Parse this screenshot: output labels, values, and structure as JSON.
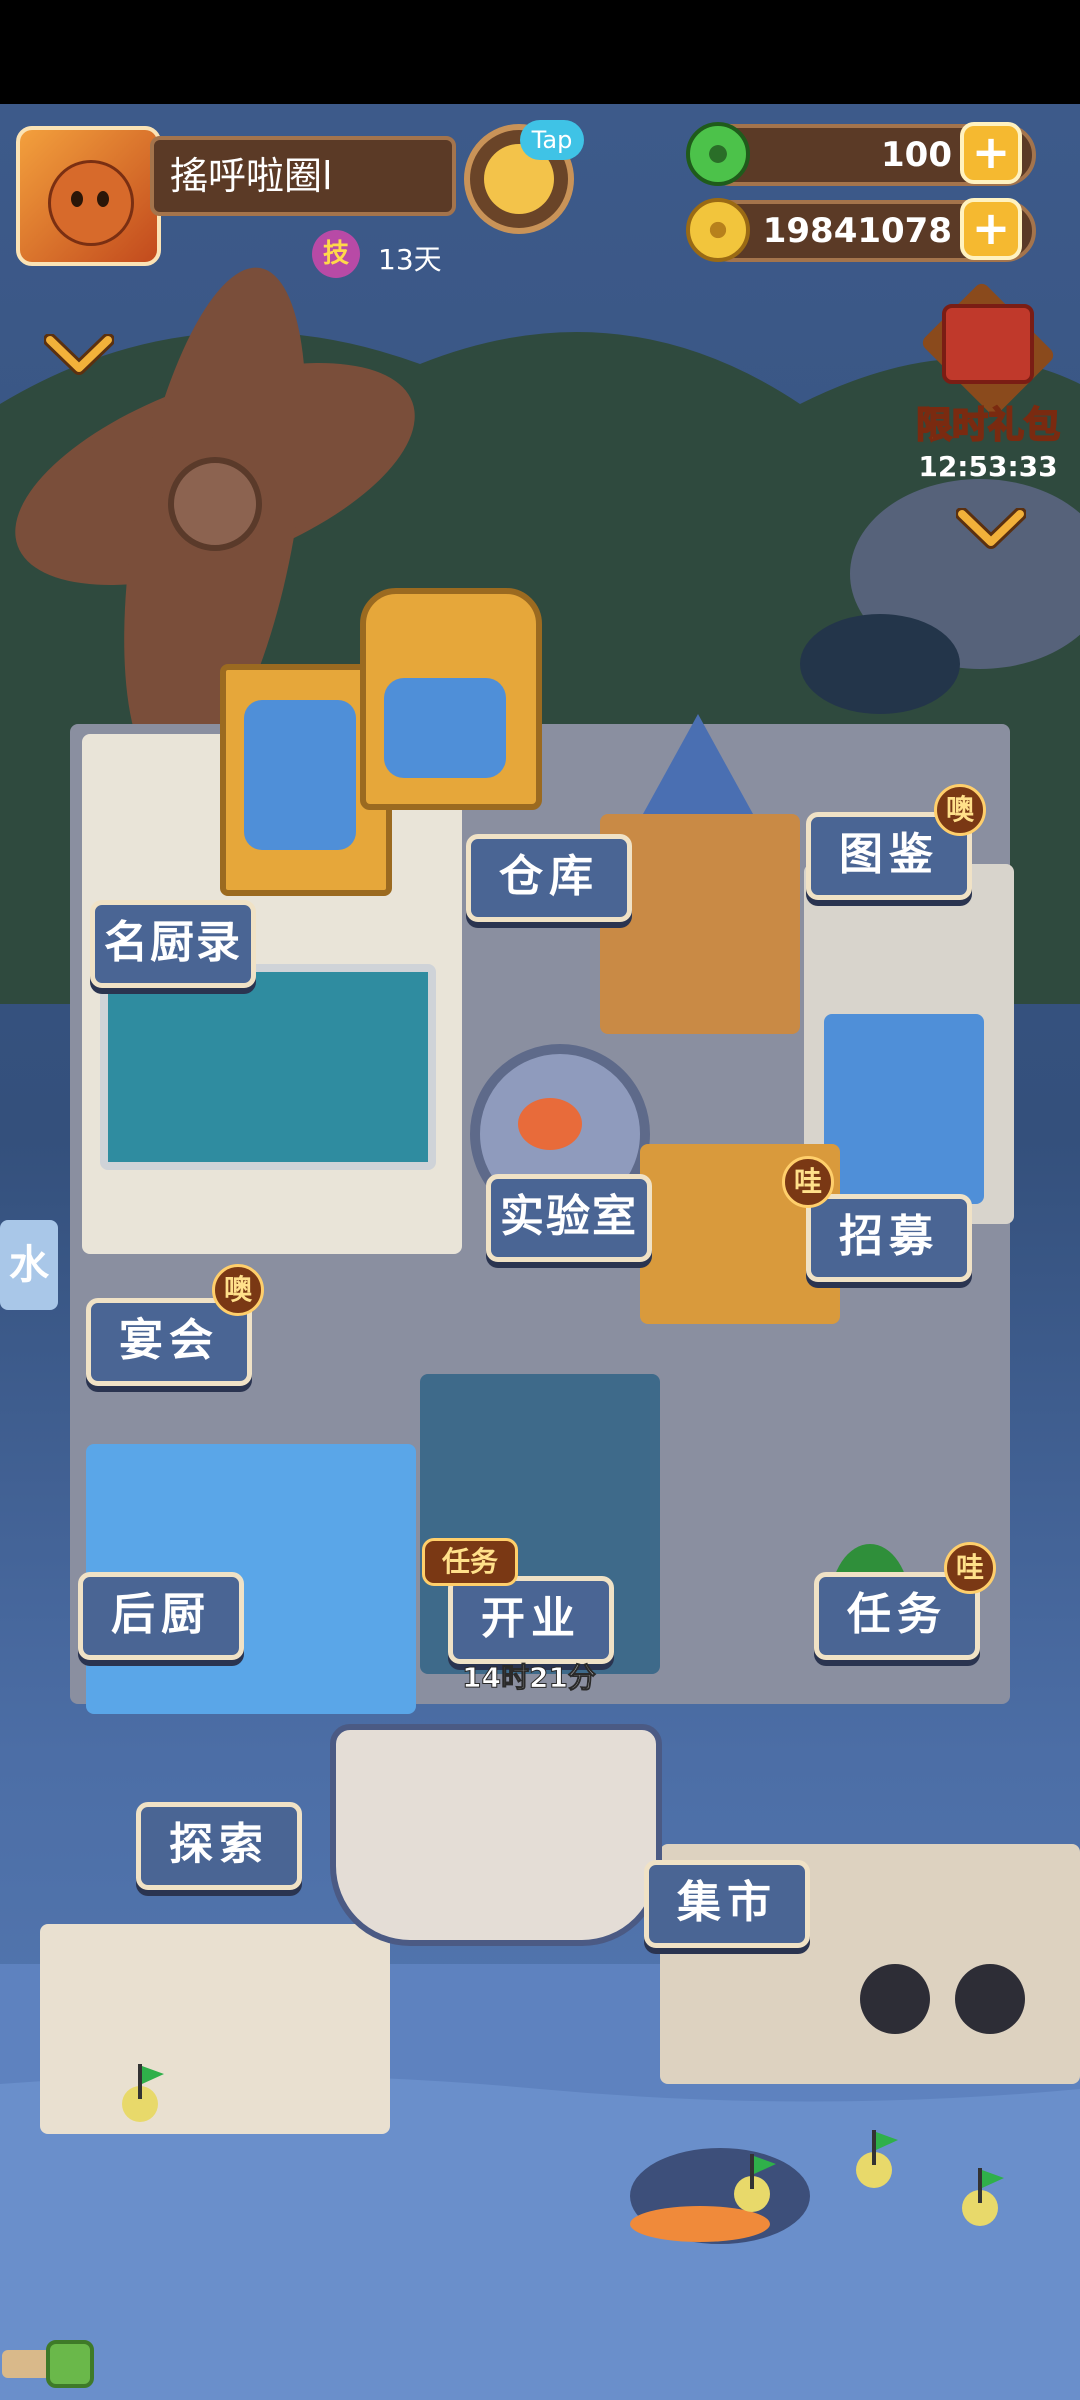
{
  "player": {
    "name": "搖呼啦圈l",
    "tap_label": "Tap",
    "skill_badge": "技",
    "days": "13天"
  },
  "resources": {
    "jade": "100",
    "coins": "19841078",
    "plus": "+"
  },
  "gift": {
    "label": "限时礼包",
    "timer": "12:53:33"
  },
  "buildings": {
    "warehouse": "仓库",
    "catalog": "图鉴",
    "catalog_badge": "噢",
    "chefs": "名厨录",
    "lab": "实验室",
    "recruit": "招募",
    "recruit_badge": "哇",
    "banquet": "宴会",
    "banquet_badge": "噢",
    "kitchen": "后厨",
    "open": "开业",
    "open_badge": "任务",
    "open_timer": "14时21分",
    "quests": "任务",
    "quests_badge": "哇",
    "explore": "探索",
    "market": "集市",
    "water_sign": "水"
  },
  "colors": {
    "label_bg": "#4a6594",
    "label_border": "#f0e2c6",
    "badge_bg": "#7a3814",
    "hud_bar": "#5b3a26",
    "plus_btn": "#f5b930"
  }
}
